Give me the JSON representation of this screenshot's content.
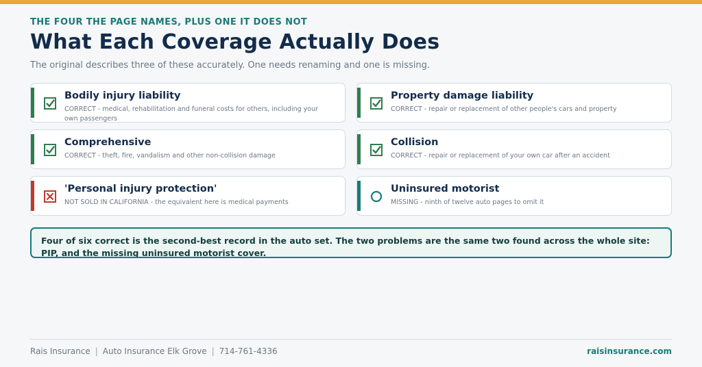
{
  "header": {
    "eyebrow": "THE FOUR THE PAGE NAMES, PLUS ONE IT DOES NOT",
    "title": "What Each Coverage Actually Does",
    "subtitle": "The original describes three of these accurately. One needs renaming and one is missing."
  },
  "colors": {
    "accent_bar": "#e9a63a",
    "correct": "#2e7d4f",
    "wrong": "#c0392b",
    "missing": "#177c78",
    "heading": "#132c4c"
  },
  "coverages": [
    {
      "status": "correct",
      "icon": "checkbox-checked-icon",
      "title": "Bodily injury liability",
      "desc": "CORRECT - medical, rehabilitation and funeral costs for others, including your own passengers"
    },
    {
      "status": "correct",
      "icon": "checkbox-checked-icon",
      "title": "Property damage liability",
      "desc": "CORRECT - repair or replacement of other people's cars and property"
    },
    {
      "status": "correct",
      "icon": "checkbox-checked-icon",
      "title": "Comprehensive",
      "desc": "CORRECT - theft, fire, vandalism and other non-collision damage"
    },
    {
      "status": "correct",
      "icon": "checkbox-checked-icon",
      "title": "Collision",
      "desc": "CORRECT - repair or replacement of your own car after an accident"
    },
    {
      "status": "wrong",
      "icon": "checkbox-x-icon",
      "title": "'Personal injury protection'",
      "desc": "NOT SOLD IN CALIFORNIA - the equivalent here is medical payments"
    },
    {
      "status": "missing",
      "icon": "empty-circle-icon",
      "title": "Uninsured motorist",
      "desc": "MISSING - ninth of twelve auto pages to omit it"
    }
  ],
  "callout": {
    "text": "Four of six correct is the second-best record in the auto set. The two problems are the same two found across the whole site: PIP, and the missing uninsured motorist cover."
  },
  "footer": {
    "company": "Rais Insurance",
    "page": "Auto Insurance Elk Grove",
    "phone": "714-761-4336",
    "separator": "|",
    "website": "raisinsurance.com"
  }
}
